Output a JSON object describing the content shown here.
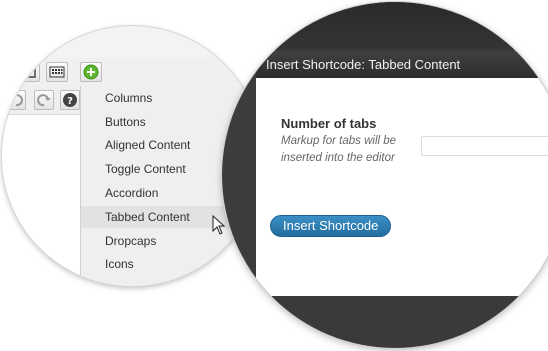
{
  "dropdown": {
    "items": [
      {
        "label": "Columns"
      },
      {
        "label": "Buttons"
      },
      {
        "label": "Aligned Content"
      },
      {
        "label": "Toggle Content"
      },
      {
        "label": "Accordion"
      },
      {
        "label": "Tabbed Content",
        "active": true
      },
      {
        "label": "Dropcaps"
      },
      {
        "label": "Icons"
      }
    ]
  },
  "toolbar": {
    "row1_buttons": [
      "fullscreen-icon",
      "kitchen-sink-icon",
      "shortcode-add-icon"
    ],
    "row2_buttons": [
      "undo-icon",
      "redo-icon",
      "help-icon"
    ]
  },
  "dialog": {
    "title": "Insert Shortcode: Tabbed Content",
    "field_label": "Number of tabs",
    "field_description": "Markup for tabs will be inserted into the editor",
    "field_value": "",
    "insert_button": "Insert Shortcode"
  },
  "colors": {
    "accent_button": "#2a78ad",
    "add_icon": "#5cb630",
    "titlebar": "#333333"
  }
}
